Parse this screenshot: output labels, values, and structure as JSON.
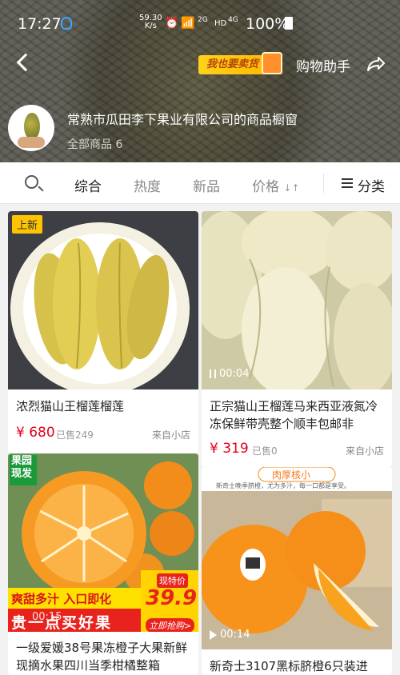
{
  "status_bar": {
    "time": "17:27",
    "speed_value": "59.30",
    "speed_unit": "K/s",
    "network_label": "2G",
    "hd_label": "HD",
    "network2_label": "4G",
    "battery": "100%"
  },
  "header": {
    "sell_badge": "我也要卖货",
    "assistant_label": "购物助手",
    "shop_name": "常熟市瓜田李下果业有限公司的商品橱窗",
    "product_count": "全部商品 6"
  },
  "filter": {
    "tabs": [
      "综合",
      "热度",
      "新品",
      "价格"
    ],
    "active_tab": "综合",
    "sort_arrows": "↓↑",
    "category_label": "分类"
  },
  "products": [
    {
      "title": "浓烈猫山王榴莲榴莲",
      "price": "¥ 680",
      "sold": "已售249",
      "source": "来自小店",
      "tag": "上新"
    },
    {
      "title": "正宗猫山王榴莲马来西亚液氮冷冻保鲜带壳整个顺丰包邮非",
      "price": "¥ 319",
      "sold": "已售0",
      "source": "来自小店",
      "video_duration": "00:04"
    },
    {
      "title": "一级爱媛38号果冻橙子大果新鲜现摘水果四川当季柑橘整箱",
      "corner_label_line1": "果园",
      "corner_label_line2": "现发",
      "promo_banner": "爽甜多汁 入口即化",
      "promo_bottom": "贵一点买好果",
      "promo_price_label": "现特价",
      "promo_price": "39.9",
      "promo_cta": "立即抢购>",
      "video_duration": "00:15"
    },
    {
      "title": "新奇士3107黑标脐橙6只装进",
      "banner_label": "肉厚核小",
      "banner_sub": "新奇士晚季脐橙，尤为多汁，每一口都是享受。",
      "video_duration": "00:14"
    }
  ],
  "colors": {
    "price": "#e3001b",
    "tag_yellow": "#ffc400"
  }
}
